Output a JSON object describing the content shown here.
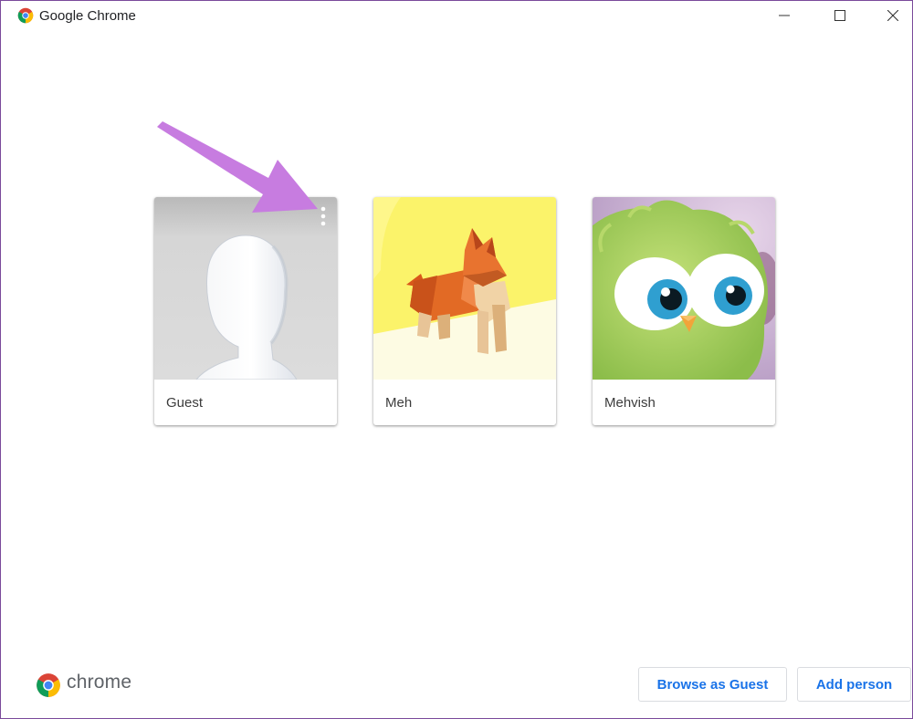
{
  "window": {
    "title": "Google Chrome",
    "controls": {
      "minimize": "minimize-icon",
      "maximize": "maximize-icon",
      "close": "close-icon"
    }
  },
  "profiles": [
    {
      "name": "Guest",
      "image": "guest-silhouette-avatar",
      "has_menu": true
    },
    {
      "name": "Meh",
      "image": "origami-corgi-avatar",
      "has_menu": false
    },
    {
      "name": "Mehvish",
      "image": "green-bird-avatar",
      "has_menu": false
    }
  ],
  "footer": {
    "brand": "chrome",
    "browse_as_guest_label": "Browse as Guest",
    "add_person_label": "Add person"
  },
  "colors": {
    "accent": "#1a73e8",
    "annotation_arrow": "#c77ce0",
    "window_border": "#7a4a9b"
  }
}
